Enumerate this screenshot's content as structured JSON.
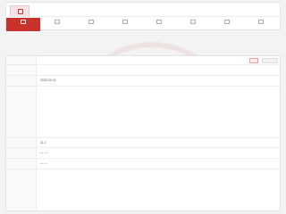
{
  "header": {
    "date_line": "",
    "case_number": "",
    "meta": [
      "",
      "",
      "",
      ""
    ]
  },
  "tabs": [
    {
      "label": "",
      "active": true
    },
    {
      "label": "",
      "active": false
    },
    {
      "label": "",
      "active": false
    },
    {
      "label": "",
      "active": false
    },
    {
      "label": "",
      "active": false
    },
    {
      "label": "",
      "active": false
    },
    {
      "label": "",
      "active": false
    },
    {
      "label": "",
      "active": false
    }
  ],
  "info": {
    "rows": [
      {
        "key": "",
        "value": "",
        "has_actions": true
      },
      {
        "key": "",
        "value": ""
      },
      {
        "key": "",
        "value": "2023-03-01"
      },
      {
        "key": "",
        "value": ""
      },
      {
        "key": "",
        "value": "11.2"
      },
      {
        "key": "",
        "value": "— —"
      },
      {
        "key": "",
        "value": "— —"
      },
      {
        "key": "",
        "value": ""
      }
    ],
    "action_label": "",
    "secondary_label": ""
  }
}
